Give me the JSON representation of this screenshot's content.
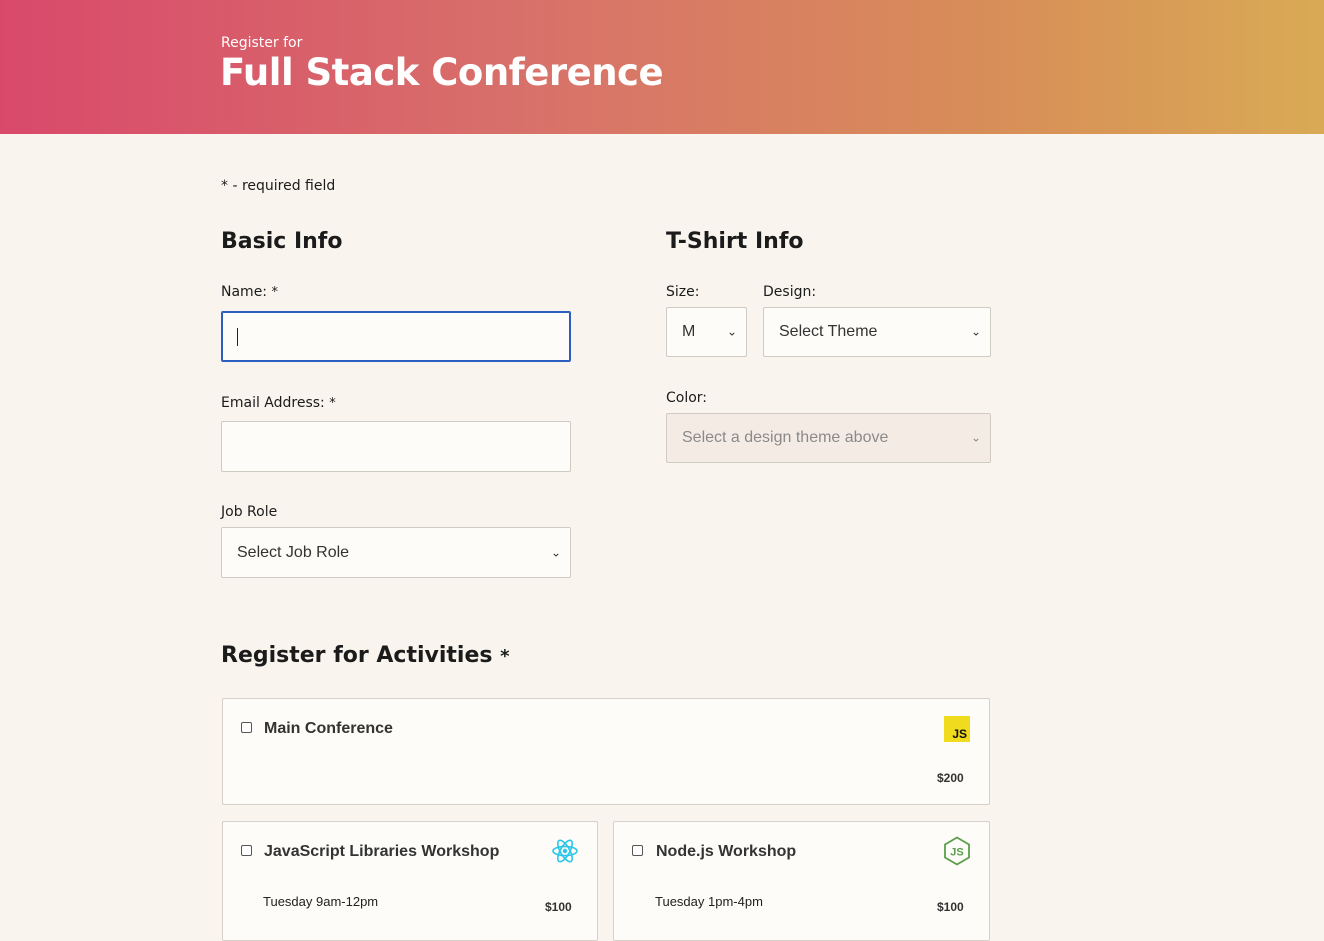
{
  "header": {
    "pretitle": "Register for",
    "title": "Full Stack Conference"
  },
  "required_note": "* - required field",
  "basic_info": {
    "heading": "Basic Info",
    "name_label": "Name:",
    "name_value": "",
    "email_label": "Email Address:",
    "email_value": "",
    "job_role_label": "Job Role",
    "job_role_selected": "Select Job Role",
    "required_mark": "*"
  },
  "tshirt_info": {
    "heading": "T-Shirt Info",
    "size_label": "Size:",
    "size_selected": "M",
    "design_label": "Design:",
    "design_selected": "Select Theme",
    "color_label": "Color:",
    "color_selected": "Select a design theme above"
  },
  "activities": {
    "heading": "Register for Activities",
    "required_mark": "*",
    "items": [
      {
        "name": "Main Conference",
        "price": "$200",
        "time": "",
        "icon": "javascript-icon",
        "checked": false
      },
      {
        "name": "JavaScript Libraries Workshop",
        "price": "$100",
        "time": "Tuesday 9am-12pm",
        "icon": "react-icon",
        "checked": false
      },
      {
        "name": "Node.js Workshop",
        "price": "$100",
        "time": "Tuesday 1pm-4pm",
        "icon": "nodejs-icon",
        "checked": false
      }
    ]
  },
  "colors": {
    "gradient_start": "#d9496b",
    "gradient_end": "#d9aa55",
    "page_background": "#f9f5ee",
    "focus_border": "#2a5fbf",
    "js_yellow": "#f0db1e",
    "react_cyan": "#2bc6e8",
    "node_green": "#5a9e4b"
  }
}
